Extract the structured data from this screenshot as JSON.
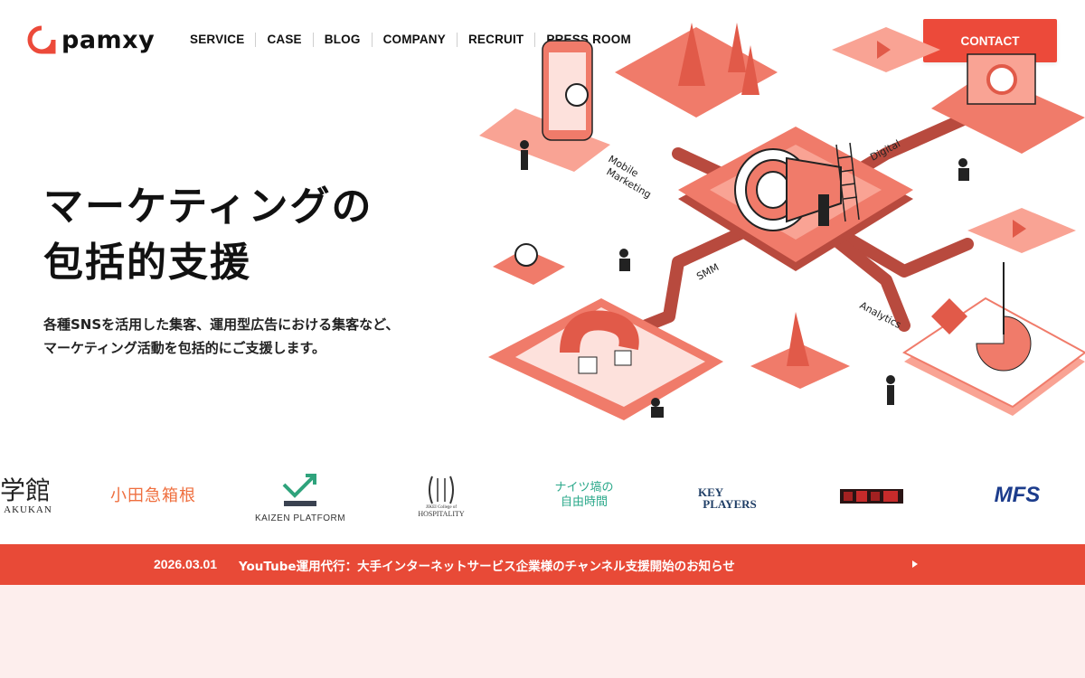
{
  "brand": {
    "name": "pamxy",
    "accent": "#ec4a3a"
  },
  "nav": {
    "items": [
      "SERVICE",
      "CASE",
      "BLOG",
      "COMPANY",
      "RECRUIT",
      "PRESS ROOM"
    ],
    "contact_label": "CONTACT"
  },
  "hero": {
    "title_line1": "マーケティングの",
    "title_line2": "包括的支援",
    "subtitle_line1": "各種SNSを活用した集客、運用型広告における集客など、",
    "subtitle_line2": "マーケティング活動を包括的にご支援します。"
  },
  "illustration": {
    "labels": [
      "Mobile",
      "Marketing",
      "Digital",
      "SMM",
      "Analytics"
    ],
    "colors": {
      "primary": "#f07b6a",
      "dark": "#b84a3e",
      "light": "#f9c3b9"
    }
  },
  "clients": [
    {
      "name": "学館",
      "sub": "AKUKAN"
    },
    {
      "name": "小田急箱根"
    },
    {
      "name": "KAIZEN PLATFORM"
    },
    {
      "name": "JIKEI College of",
      "sub": "HOSPITALITY"
    },
    {
      "name": "ナイツ塙の",
      "sub": "自由時間"
    },
    {
      "name": "KEY",
      "sub": "PLAYERS"
    },
    {
      "name": "MFS"
    }
  ],
  "news": {
    "date": "2026.03.01",
    "text": "YouTube運用代行：大手インターネットサービス企業様のチャンネル支援開始のお知らせ",
    "arrow_icon": "chevron-right-icon"
  }
}
